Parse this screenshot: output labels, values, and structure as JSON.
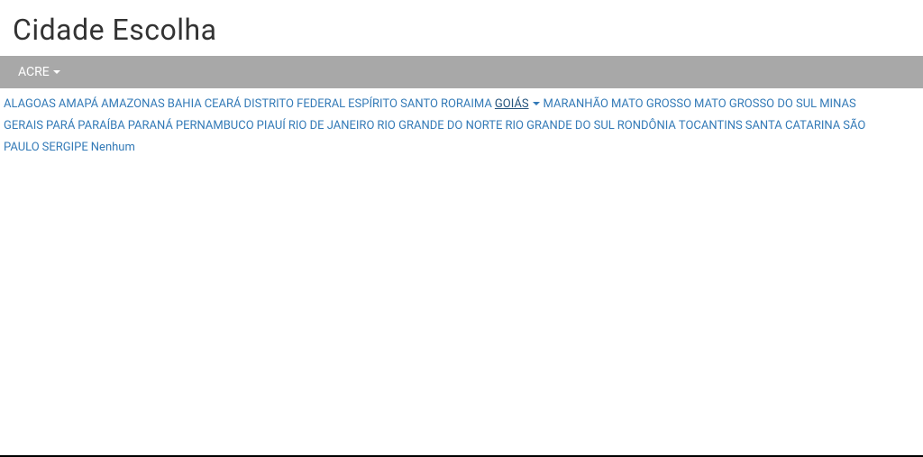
{
  "title": "Cidade Escolha",
  "primaryDropdown": {
    "label": "ACRE"
  },
  "states": [
    {
      "label": "ALAGOAS",
      "hasDropdown": false,
      "underlined": false
    },
    {
      "label": "AMAPÁ",
      "hasDropdown": false,
      "underlined": false
    },
    {
      "label": "AMAZONAS",
      "hasDropdown": false,
      "underlined": false
    },
    {
      "label": "BAHIA",
      "hasDropdown": false,
      "underlined": false
    },
    {
      "label": "CEARÁ",
      "hasDropdown": false,
      "underlined": false
    },
    {
      "label": "DISTRITO FEDERAL",
      "hasDropdown": false,
      "underlined": false
    },
    {
      "label": "ESPÍRITO SANTO",
      "hasDropdown": false,
      "underlined": false
    },
    {
      "label": "RORAIMA",
      "hasDropdown": false,
      "underlined": false
    },
    {
      "label": "GOIÁS",
      "hasDropdown": true,
      "underlined": true
    },
    {
      "label": "MARANHÃO",
      "hasDropdown": false,
      "underlined": false
    },
    {
      "label": "MATO GROSSO",
      "hasDropdown": false,
      "underlined": false
    },
    {
      "label": "MATO GROSSO DO SUL",
      "hasDropdown": false,
      "underlined": false
    },
    {
      "label": "MINAS GERAIS",
      "hasDropdown": false,
      "underlined": false
    },
    {
      "label": "PARÁ",
      "hasDropdown": false,
      "underlined": false
    },
    {
      "label": "PARAÍBA",
      "hasDropdown": false,
      "underlined": false
    },
    {
      "label": "PARANÁ",
      "hasDropdown": false,
      "underlined": false
    },
    {
      "label": "PERNAMBUCO",
      "hasDropdown": false,
      "underlined": false
    },
    {
      "label": "PIAUÍ",
      "hasDropdown": false,
      "underlined": false
    },
    {
      "label": "RIO DE JANEIRO",
      "hasDropdown": false,
      "underlined": false
    },
    {
      "label": "RIO GRANDE DO NORTE",
      "hasDropdown": false,
      "underlined": false
    },
    {
      "label": "RIO GRANDE DO SUL",
      "hasDropdown": false,
      "underlined": false
    },
    {
      "label": "RONDÔNIA",
      "hasDropdown": false,
      "underlined": false
    },
    {
      "label": "TOCANTINS",
      "hasDropdown": false,
      "underlined": false
    },
    {
      "label": "SANTA CATARINA",
      "hasDropdown": false,
      "underlined": false
    },
    {
      "label": "SÃO PAULO",
      "hasDropdown": false,
      "underlined": false
    },
    {
      "label": "SERGIPE",
      "hasDropdown": false,
      "underlined": false
    },
    {
      "label": "Nenhum",
      "hasDropdown": false,
      "underlined": false
    }
  ]
}
